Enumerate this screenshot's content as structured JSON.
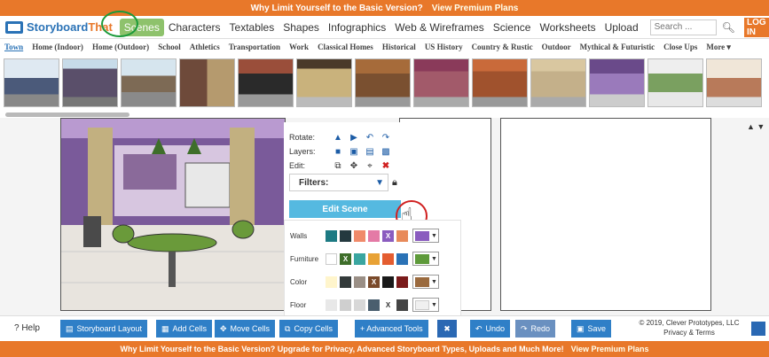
{
  "top_banner": {
    "text": "Why Limit Yourself to the Basic Version?",
    "link": "View Premium Plans"
  },
  "nav": {
    "logo_a": "Storyboard",
    "logo_b": "That",
    "items": [
      "Scenes",
      "Characters",
      "Textables",
      "Shapes",
      "Infographics",
      "Web & Wireframes",
      "Science",
      "Worksheets",
      "Upload"
    ],
    "search_placeholder": "Search ...",
    "login": "LOG IN"
  },
  "categories": [
    "Town",
    "Home (Indoor)",
    "Home (Outdoor)",
    "School",
    "Athletics",
    "Transportation",
    "Work",
    "Classical Homes",
    "Historical",
    "US History",
    "Country & Rustic",
    "Outdoor",
    "Mythical & Futuristic",
    "Close Ups",
    "More ▾"
  ],
  "toolbox": {
    "rotate": "Rotate:",
    "layers": "Layers:",
    "edit": "Edit:",
    "filters": "Filters:",
    "edit_scene": "Edit Scene"
  },
  "palette": {
    "walls": "Walls",
    "furniture": "Furniture",
    "color": "Color",
    "floor": "Floor",
    "walls_colors": [
      "#1d7a83",
      "#24393f",
      "#f08a6a",
      "#e47aa6",
      "#8a5cbf",
      "#ffffff"
    ],
    "furniture_colors": [
      "#ffffff",
      "#3e6e2a",
      "#3aa6a0",
      "#e8a235",
      "#e45d30",
      "#2a72b6"
    ],
    "color_colors": [
      "#fff5cc",
      "#333a3a",
      "#9a8f86",
      "#7a4a2a",
      "#1a1a1a",
      "#7a1a1a"
    ],
    "floor_colors": [
      "#e8e8e8",
      "#cfcfcf",
      "#d8d8d8",
      "#4a5e6e",
      "#ffffff",
      "#444444"
    ],
    "selected_walls": "#8a5cbf",
    "selected_furniture": "#5e9a3a",
    "selected_color": "#9a6a3e",
    "selected_floor": "#f0f0f0",
    "x_mark": "X"
  },
  "bottom": {
    "help": "? Help",
    "storyboard_layout": "Storyboard Layout",
    "add_cells": "Add Cells",
    "move_cells": "Move Cells",
    "copy_cells": "Copy Cells",
    "advanced_tools": "+ Advanced Tools",
    "undo": "Undo",
    "redo": "Redo",
    "save": "Save",
    "copyright_line1": "© 2019, Clever Prototypes, LLC",
    "copyright_line2": "Privacy & Terms"
  },
  "bottom_banner": {
    "text": "Why Limit Yourself to the Basic Version? Upgrade for Privacy, Advanced Storyboard Types, Uploads and Much More!",
    "link": "View Premium Plans"
  }
}
